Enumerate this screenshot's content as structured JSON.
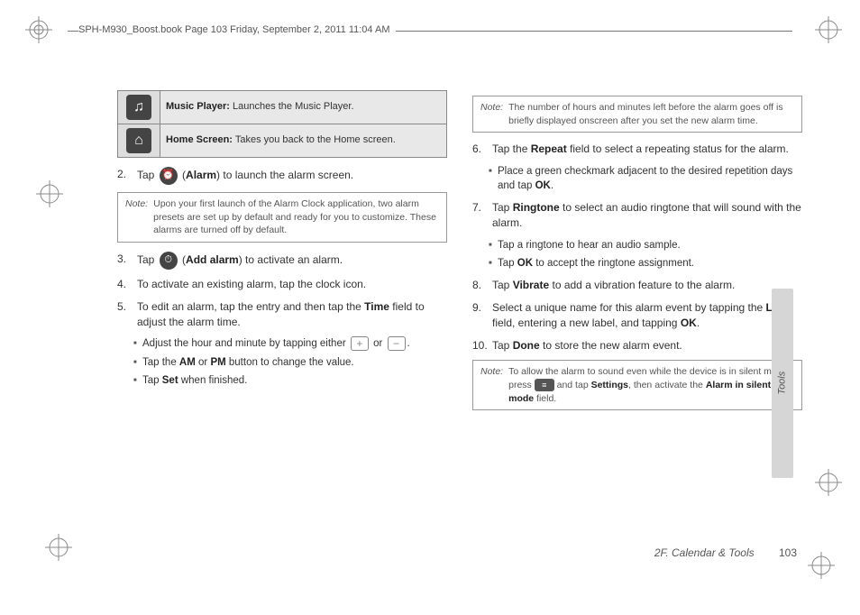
{
  "header": "SPH-M930_Boost.book  Page 103  Friday, September 2, 2011  11:04 AM",
  "icon_table": [
    {
      "icon": "music-icon",
      "label": "Music Player:",
      "desc": "Launches the Music Player."
    },
    {
      "icon": "home-icon",
      "label": "Home Screen:",
      "desc": "Takes you back to the Home screen."
    }
  ],
  "left": {
    "step2_a": "Tap ",
    "step2_b": " (",
    "step2_bold": "Alarm",
    "step2_c": ") to launch the alarm screen.",
    "note1_label": "Note:",
    "note1_text": "Upon your first launch of the Alarm Clock application, two alarm presets are set up by default and ready for you to customize. These alarms are turned off by default.",
    "step3_a": "Tap ",
    "step3_b": " (",
    "step3_bold": "Add alarm",
    "step3_c": ") to activate an alarm.",
    "step4": "To activate an existing alarm, tap the clock icon.",
    "step5_a": "To edit an alarm, tap the entry and then tap the ",
    "step5_bold": "Time",
    "step5_b": " field to adjust the alarm time.",
    "sub5a_a": "Adjust the hour and minute by tapping either ",
    "sub5a_b": " or ",
    "sub5a_c": ".",
    "sub5b_a": "Tap the ",
    "sub5b_bold1": "AM",
    "sub5b_mid": " or ",
    "sub5b_bold2": "PM",
    "sub5b_b": " button to change the value.",
    "sub5c_a": "Tap ",
    "sub5c_bold": "Set",
    "sub5c_b": " when finished."
  },
  "right": {
    "note2_label": "Note:",
    "note2_text": "The number of hours and minutes left before the alarm goes off is briefly displayed onscreen after you set the new alarm time.",
    "step6_a": "Tap the ",
    "step6_bold": "Repeat",
    "step6_b": " field to select a repeating status for the alarm.",
    "sub6_a": "Place a green checkmark adjacent to the desired repetition days and tap ",
    "sub6_bold": "OK",
    "sub6_b": ".",
    "step7_a": "Tap ",
    "step7_bold": "Ringtone",
    "step7_b": " to select an audio ringtone that will sound with the alarm.",
    "sub7a": "Tap a ringtone to hear an audio sample.",
    "sub7b_a": "Tap ",
    "sub7b_bold": "OK",
    "sub7b_b": " to accept the ringtone assignment.",
    "step8_a": "Tap ",
    "step8_bold": "Vibrate",
    "step8_b": " to add a vibration feature to the alarm.",
    "step9_a": "Select a unique name for this alarm event by tapping the ",
    "step9_bold": "Label",
    "step9_b": " field, entering a new label, and tapping ",
    "step9_bold2": "OK",
    "step9_c": ".",
    "step10_a": "Tap ",
    "step10_bold": "Done",
    "step10_b": " to store the new alarm event.",
    "note3_label": "Note:",
    "note3_a": "To allow the alarm to sound even while the device is in silent mode, press ",
    "note3_b": " and tap ",
    "note3_bold1": "Settings",
    "note3_c": ", then activate the ",
    "note3_bold2": "Alarm in silent mode",
    "note3_d": " field."
  },
  "side_tab": "Tools",
  "footer_section": "2F. Calendar & Tools",
  "footer_page": "103",
  "step_nums": {
    "s2": "2.",
    "s3": "3.",
    "s4": "4.",
    "s5": "5.",
    "s6": "6.",
    "s7": "7.",
    "s8": "8.",
    "s9": "9.",
    "s10": "10."
  }
}
